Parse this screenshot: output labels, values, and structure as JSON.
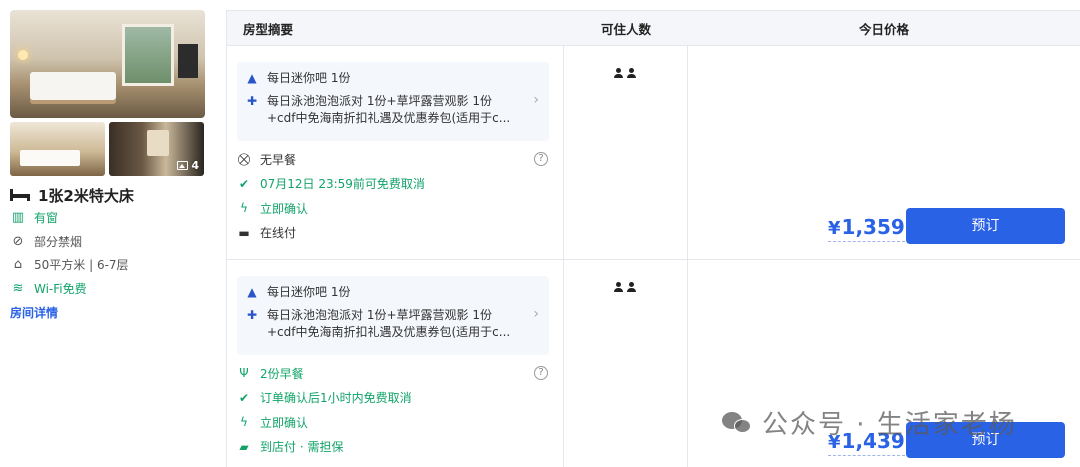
{
  "room": {
    "photo_count": "4",
    "name": "1张2米特大床",
    "features": [
      {
        "icon": "window-icon",
        "label": "有窗",
        "green": true
      },
      {
        "icon": "no-smoking-icon",
        "label": "部分禁烟",
        "green": false
      },
      {
        "icon": "area-icon",
        "label": "50平方米 | 6-7层",
        "green": false
      },
      {
        "icon": "wifi-icon",
        "label": "Wi-Fi免费",
        "green": true
      }
    ],
    "detail_link": "房间详情"
  },
  "table": {
    "headers": {
      "summary": "房型摘要",
      "guests": "可住人数",
      "price": "今日价格"
    },
    "rows": [
      {
        "perks": [
          {
            "icon": "minibar-icon",
            "line1": "每日迷你吧 1份",
            "line2": ""
          },
          {
            "icon": "gift-icon",
            "line1": "每日泳池泡泡派对 1份+草坪露营观影 1份",
            "line2": "+cdf中免海南折扣礼遇及优惠券包(适用于c..."
          }
        ],
        "policies": [
          {
            "icon": "no-breakfast-icon",
            "label": "无早餐",
            "green": false,
            "help": true
          },
          {
            "icon": "check-circle-icon",
            "label": "07月12日 23:59前可免费取消",
            "green": true,
            "help": false
          },
          {
            "icon": "lightning-icon",
            "label": "立即确认",
            "green": true,
            "help": false
          },
          {
            "icon": "card-icon",
            "label": "在线付",
            "green": false,
            "help": false
          }
        ],
        "guests": 2,
        "price": {
          "currency": "¥",
          "amount": "1,359"
        },
        "book_label": "预订"
      },
      {
        "perks": [
          {
            "icon": "minibar-icon",
            "line1": "每日迷你吧 1份",
            "line2": ""
          },
          {
            "icon": "gift-icon",
            "line1": "每日泳池泡泡派对 1份+草坪露营观影 1份",
            "line2": "+cdf中免海南折扣礼遇及优惠券包(适用于c..."
          }
        ],
        "policies": [
          {
            "icon": "breakfast-icon",
            "label": "2份早餐",
            "green": true,
            "help": true
          },
          {
            "icon": "check-circle-icon",
            "label": "订单确认后1小时内免费取消",
            "green": true,
            "help": false
          },
          {
            "icon": "lightning-icon",
            "label": "立即确认",
            "green": true,
            "help": false
          },
          {
            "icon": "pay-at-hotel-icon",
            "label": "到店付 · 需担保",
            "green": true,
            "help": false
          }
        ],
        "guests": 2,
        "price": {
          "currency": "¥",
          "amount": "1,439"
        },
        "book_label": "预订"
      }
    ]
  },
  "watermark": "公众号 · 生活家老杨",
  "colors": {
    "accent": "#2a62e6",
    "green": "#12a36a",
    "border": "#e4e7ec"
  }
}
